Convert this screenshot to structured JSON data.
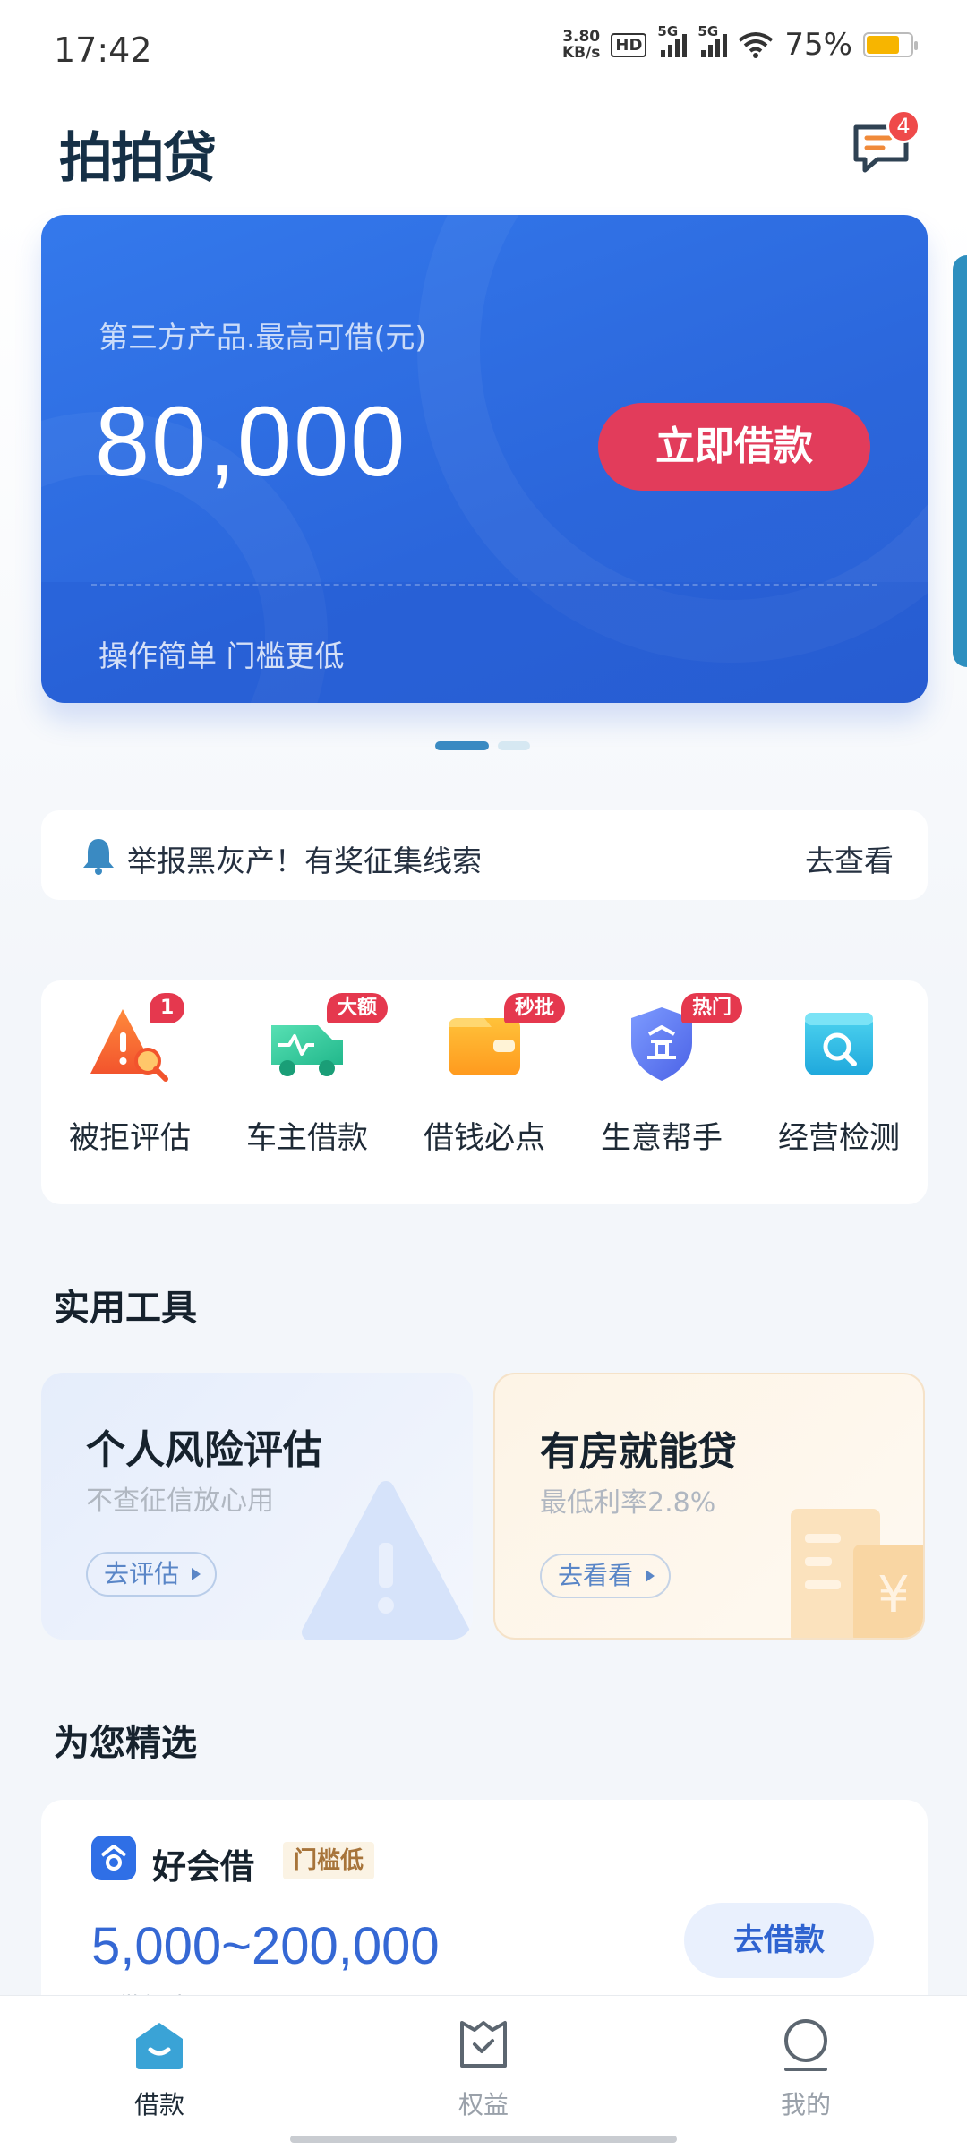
{
  "status_bar": {
    "time": "17:42",
    "net_speed_value": "3.80",
    "net_speed_unit": "KB/s",
    "hd_label": "HD",
    "signal1_label": "5G",
    "signal2_label": "5G",
    "battery_percent": "75%",
    "battery_level": 0.75
  },
  "header": {
    "app_title": "拍拍贷",
    "message_badge": "4"
  },
  "banner": {
    "subtitle": "第三方产品.最高可借(元)",
    "amount": "80,000",
    "cta_label": "立即借款",
    "tagline": "操作简单 门槛更低",
    "page_count": 2,
    "active_page": 1
  },
  "notice": {
    "text": "举报黑灰产！有奖征集线索",
    "link_label": "去查看"
  },
  "quick_actions": [
    {
      "label": "被拒评估",
      "badge": "1",
      "icon": "warning-search-icon"
    },
    {
      "label": "车主借款",
      "badge": "大额",
      "icon": "car-icon"
    },
    {
      "label": "借钱必点",
      "badge": "秒批",
      "icon": "wallet-icon"
    },
    {
      "label": "生意帮手",
      "badge": "热门",
      "icon": "business-shield-icon"
    },
    {
      "label": "经营检测",
      "badge": "",
      "icon": "magnifier-icon"
    }
  ],
  "tools": {
    "section_title": "实用工具",
    "cards": [
      {
        "title": "个人风险评估",
        "subtitle": "不查征信放心用",
        "button": "去评估"
      },
      {
        "title": "有房就能贷",
        "subtitle": "最低利率2.8%",
        "button": "去看看"
      }
    ]
  },
  "featured": {
    "section_title": "为您精选",
    "product": {
      "name": "好会借",
      "tag": "门槛低",
      "range": "5,000~200,000",
      "desc": "可借额度(元)",
      "cta": "去借款"
    }
  },
  "tabbar": {
    "items": [
      {
        "label": "借款",
        "active": true,
        "icon": "home-icon"
      },
      {
        "label": "权益",
        "active": false,
        "icon": "benefits-icon"
      },
      {
        "label": "我的",
        "active": false,
        "icon": "profile-icon"
      }
    ]
  },
  "colors": {
    "banner_blue": "#2b66db",
    "cta_red": "#e23c5b",
    "badge_red": "#e5384e",
    "accent_teal": "#3a8ac2"
  }
}
